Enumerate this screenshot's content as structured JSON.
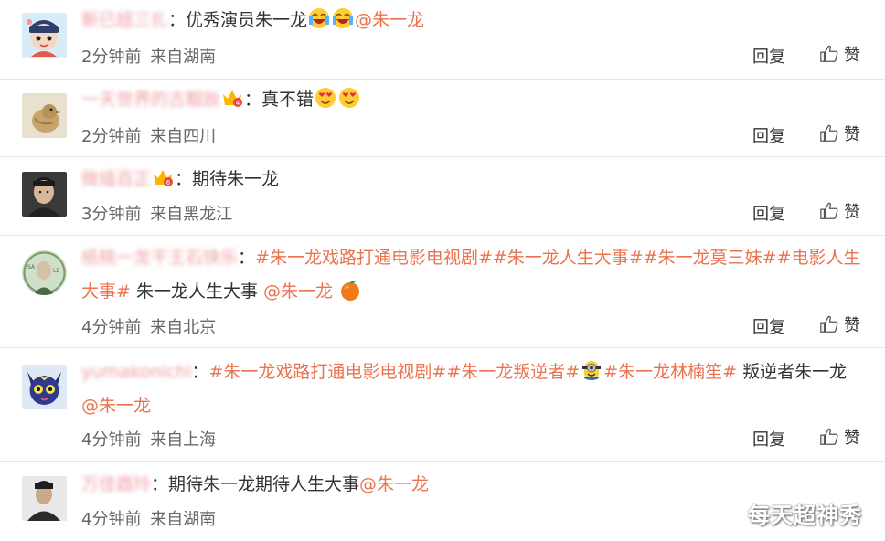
{
  "comments": [
    {
      "username": "新已妞三扎",
      "colon": "：",
      "text": "优秀演员朱一龙",
      "mention": "@朱一龙",
      "time": "2分钟前",
      "location": "来自湖南",
      "reply": "回复",
      "like": "赞"
    },
    {
      "username": "一天世界的古靓妝",
      "colon": "：",
      "text": "真不错",
      "time": "2分钟前",
      "location": "来自四川",
      "reply": "回复",
      "like": "赞"
    },
    {
      "username": "微插百正",
      "colon": "：",
      "text": "期待朱一龙",
      "time": "3分钟前",
      "location": "来自黑龙江",
      "reply": "回复",
      "like": "赞"
    },
    {
      "username": "纸桃一龙干王石快乐",
      "colon": "：",
      "topic1": "#朱一龙戏路打通电影电视剧##朱一龙人生大事##朱一龙莫三妹##电影人生大事#",
      "text": " 朱一龙人生大事 ",
      "mention": "@朱一龙",
      "time": "4分钟前",
      "location": "来自北京",
      "reply": "回复",
      "like": "赞"
    },
    {
      "username": "yumakonichi",
      "colon": "：",
      "topic1": "#朱一龙戏路打通电影电视剧##朱一龙叛逆者#",
      "topic2": "#朱一龙林楠笙#",
      "text": " 叛逆者朱一龙",
      "mention": "@朱一龙",
      "time": "4分钟前",
      "location": "来自上海",
      "reply": "回复",
      "like": "赞"
    },
    {
      "username": "万佳酉玲",
      "colon": "：",
      "text": "期待朱一龙期待人生大事",
      "mention": "@朱一龙",
      "time": "4分钟前",
      "location": "来自湖南",
      "reply": "回复",
      "like": "赞"
    }
  ],
  "watermark": "每天超神秀",
  "colors": {
    "link": "#eb7350",
    "text": "#333333",
    "meta": "#666666",
    "divider": "#e6e6e6"
  },
  "icons": {
    "like": "thumbs-up-icon",
    "emoji": "laughing-emoji-icon",
    "badge": "crown-badge-icon",
    "fruit": "orange-emoji-icon",
    "minion": "minion-emoji-icon"
  }
}
